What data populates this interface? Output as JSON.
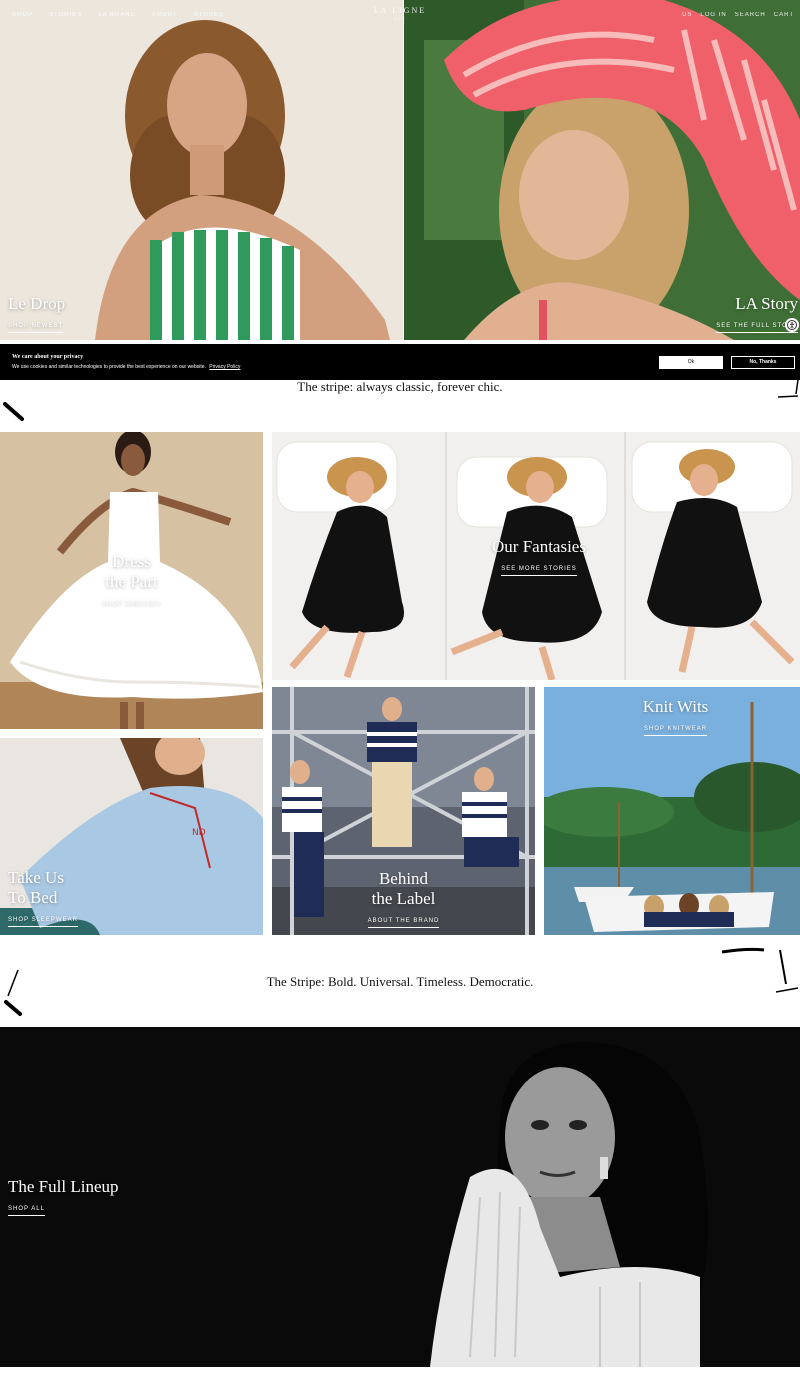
{
  "nav": {
    "left": [
      "SHOP",
      "STORIES",
      "LA BRAND",
      "ABOUT",
      "STORES"
    ],
    "logo": "LA LIGNE",
    "logo_sub": "NYC",
    "right": [
      "US",
      "LOG IN",
      "SEARCH",
      "CART"
    ]
  },
  "hero": {
    "left": {
      "title": "Le Drop",
      "link": "SHOP NEWEST"
    },
    "right": {
      "title": "LA Story",
      "link": "SEE THE FULL STORY"
    }
  },
  "cookie": {
    "title": "We care about your privacy",
    "body": "We use cookies and similar technologies to provide the best experience on our website.",
    "policy_link": "Privacy Policy",
    "ok_label": "Ok",
    "no_label": "No, Thanks"
  },
  "taglines": {
    "first": "The stripe: always classic, forever chic.",
    "second": "The Stripe: Bold. Universal. Timeless. Democratic."
  },
  "tiles": {
    "dress": {
      "title": "Dress\nthe Part",
      "link": "SHOP DRESSES"
    },
    "fantasies": {
      "title": "Our Fantasies",
      "link": "SEE MORE STORIES"
    },
    "bed": {
      "title": "Take Us\nTo Bed",
      "link": "SHOP SLEEPWEAR"
    },
    "behind": {
      "title": "Behind\nthe Label",
      "link": "ABOUT THE BRAND"
    },
    "knit": {
      "title": "Knit Wits",
      "link": "SHOP KNITWEAR"
    },
    "lineup": {
      "title": "The Full Lineup",
      "link": "SHOP ALL"
    }
  },
  "colors": {
    "accent_pink": "#f0606a",
    "stripe_green": "#2f9a5c",
    "navy": "#1f2c55",
    "banner": "#000000"
  },
  "icons": [
    "accessibility-icon",
    "brush-stroke-icon"
  ]
}
